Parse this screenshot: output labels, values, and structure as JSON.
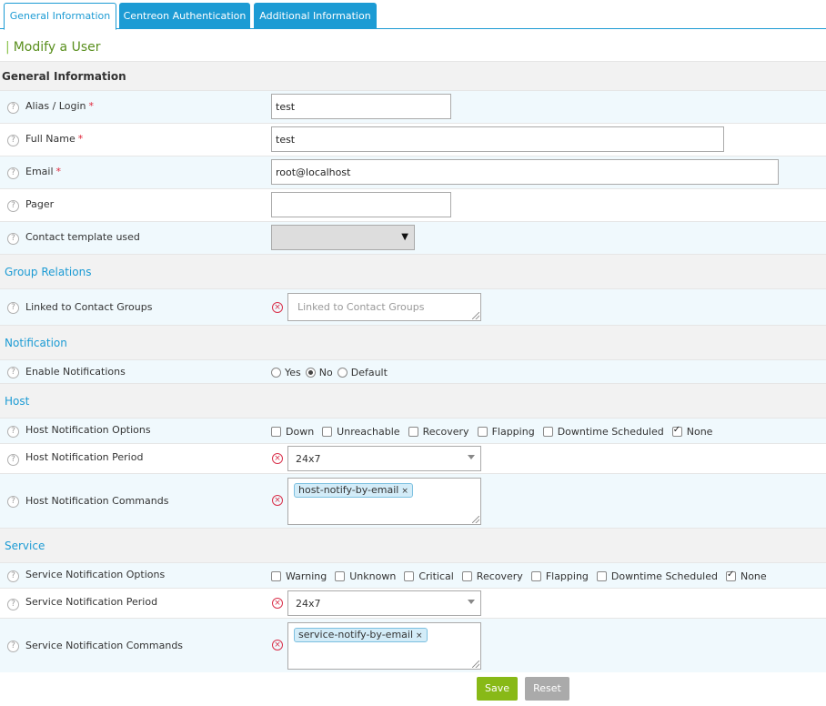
{
  "tabs": [
    {
      "label": "General Information",
      "active": true
    },
    {
      "label": "Centreon Authentication",
      "active": false
    },
    {
      "label": "Additional Information",
      "active": false
    }
  ],
  "page_title": "Modify a User",
  "section_general": "General Information",
  "fields": {
    "alias": {
      "label": "Alias / Login",
      "value": "test",
      "required": "*"
    },
    "fullname": {
      "label": "Full Name",
      "value": "test",
      "required": "*"
    },
    "email": {
      "label": "Email",
      "value": "root@localhost",
      "required": "*"
    },
    "pager": {
      "label": "Pager",
      "value": ""
    },
    "template": {
      "label": "Contact template used",
      "value": ""
    }
  },
  "group_relations": {
    "title": "Group Relations",
    "linked_label": "Linked to Contact Groups",
    "linked_placeholder": "Linked to Contact Groups"
  },
  "notification": {
    "title": "Notification",
    "enable_label": "Enable Notifications",
    "options": [
      "Yes",
      "No",
      "Default"
    ],
    "selected": "No"
  },
  "host": {
    "title": "Host",
    "options_label": "Host Notification Options",
    "options": [
      {
        "label": "Down",
        "checked": false
      },
      {
        "label": "Unreachable",
        "checked": false
      },
      {
        "label": "Recovery",
        "checked": false
      },
      {
        "label": "Flapping",
        "checked": false
      },
      {
        "label": "Downtime Scheduled",
        "checked": false
      },
      {
        "label": "None",
        "checked": true
      }
    ],
    "period_label": "Host Notification Period",
    "period_value": "24x7",
    "commands_label": "Host Notification Commands",
    "command_chip": "host-notify-by-email"
  },
  "service": {
    "title": "Service",
    "options_label": "Service Notification Options",
    "options": [
      {
        "label": "Warning",
        "checked": false
      },
      {
        "label": "Unknown",
        "checked": false
      },
      {
        "label": "Critical",
        "checked": false
      },
      {
        "label": "Recovery",
        "checked": false
      },
      {
        "label": "Flapping",
        "checked": false
      },
      {
        "label": "Downtime Scheduled",
        "checked": false
      },
      {
        "label": "None",
        "checked": true
      }
    ],
    "period_label": "Service Notification Period",
    "period_value": "24x7",
    "commands_label": "Service Notification Commands",
    "command_chip": "service-notify-by-email"
  },
  "buttons": {
    "save": "Save",
    "reset": "Reset"
  },
  "icons": {
    "help": "help-circle-icon",
    "clear": "clear-x-icon",
    "dropdown": "dropdown-arrow-icon"
  },
  "colors": {
    "accent": "#1c9bd4",
    "title_green": "#5a8f1e",
    "save": "#88b917",
    "reset": "#aaaaaa",
    "required": "#e0263a"
  }
}
